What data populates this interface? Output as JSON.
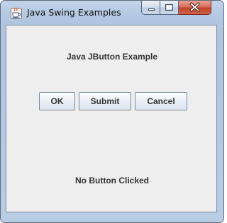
{
  "window": {
    "title": "Java Swing Examples",
    "app_icon": "java-coffee-cup-icon",
    "controls": {
      "minimize_icon": "minimize-icon",
      "maximize_icon": "maximize-icon",
      "close_icon": "close-icon"
    }
  },
  "main": {
    "heading": "Java JButton Example",
    "buttons": [
      {
        "label": "OK"
      },
      {
        "label": "Submit"
      },
      {
        "label": "Cancel"
      }
    ],
    "status_text": "No Button Clicked"
  },
  "colors": {
    "close_button": "#c4432a",
    "content_background": "#eeeeee",
    "text": "#333333"
  }
}
